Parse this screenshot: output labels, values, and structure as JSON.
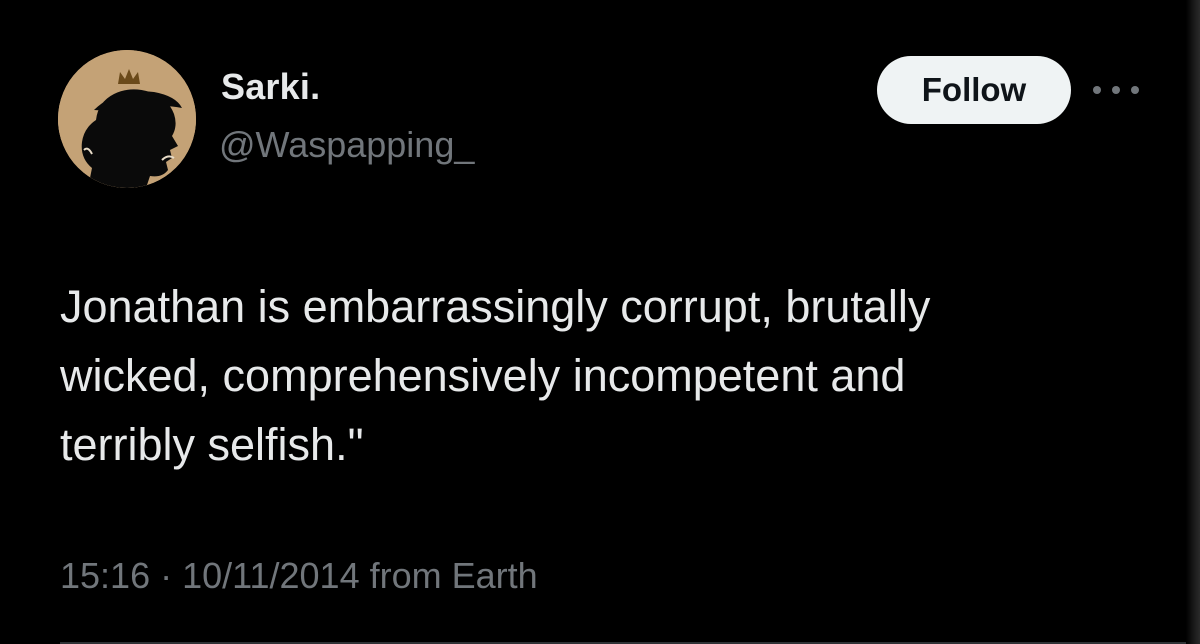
{
  "author": {
    "display_name": "Sarki.",
    "handle": "@Waspapping_",
    "avatar_icon": "silhouette-with-crown-icon",
    "avatar_bg": "#c9a77a"
  },
  "follow_button": {
    "label": "Follow"
  },
  "more_menu": {
    "icon": "more-horizontal-icon"
  },
  "tweet": {
    "text": "Jonathan is embarrassingly corrupt, brutally\nwicked, comprehensively incompetent and\nterribly selfish.\"",
    "timestamp": "15:16 · 10/11/2014 from Earth"
  },
  "colors": {
    "background": "#000000",
    "text_primary": "#e7e9ea",
    "text_secondary": "#71767b",
    "button_bg": "#eff3f4",
    "button_text": "#0f1419"
  }
}
